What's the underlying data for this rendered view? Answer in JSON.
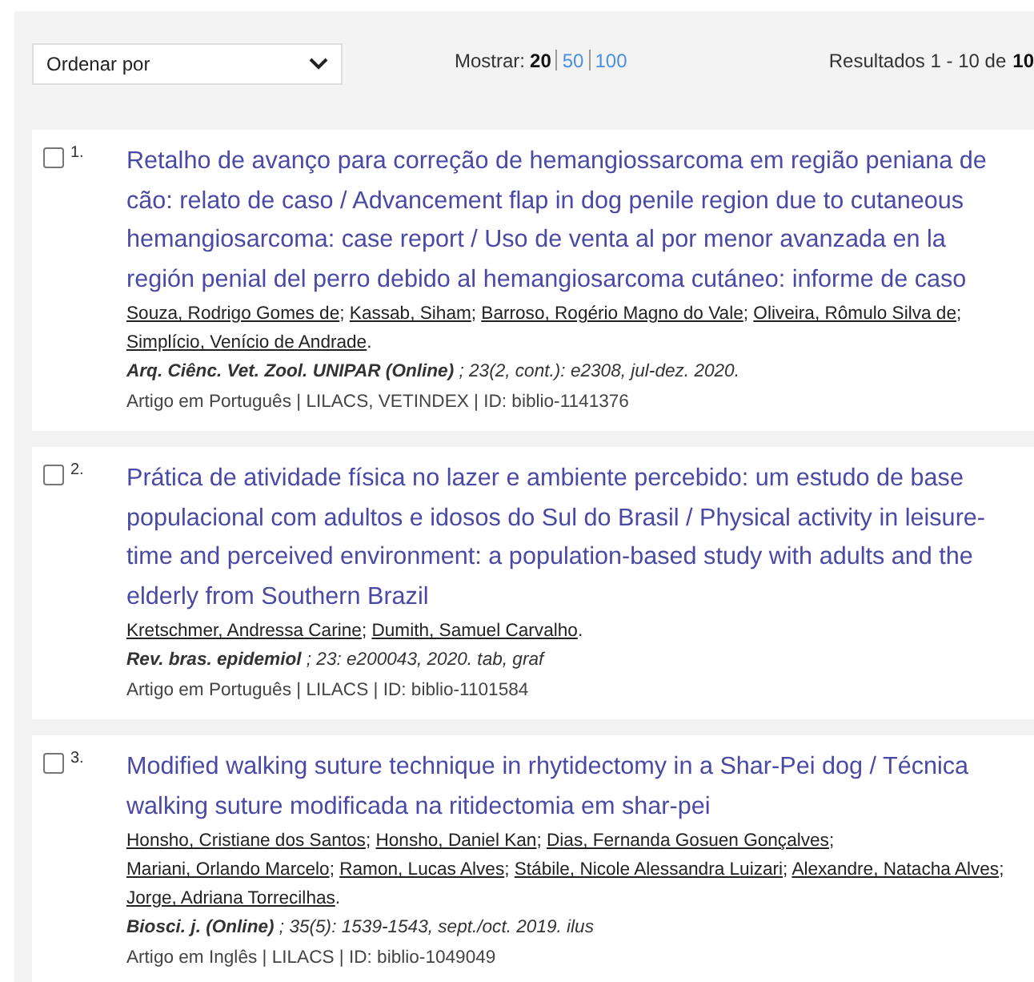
{
  "toolbar": {
    "sort": {
      "label": "Ordenar por"
    },
    "show": {
      "label": "Mostrar:",
      "options": [
        {
          "label": "20",
          "selected": true
        },
        {
          "label": "50",
          "selected": false
        },
        {
          "label": "100",
          "selected": false
        }
      ]
    },
    "results": {
      "label": "Resultados 1 - 10 de",
      "total": "10"
    }
  },
  "results": [
    {
      "checked": false,
      "number": "1.",
      "title": "Retalho de avanço para correção de hemangiossarcoma em região peniana de cão: relato de caso / Advancement flap in dog penile region due to cutaneous hemangiosarcoma: case report / Uso de venta al por menor avanzada en la región penial del perro debido al hemangiosarcoma cutáneo: informe de caso",
      "authors": [
        {
          "name": "Souza, Rodrigo Gomes de",
          "after": ";"
        },
        {
          "name": "Kassab, Siham",
          "after": ";"
        },
        {
          "name": "Barroso, Rogério Magno do Vale",
          "after": ";"
        },
        {
          "name": "Oliveira, Rômulo Silva de",
          "after": ";"
        },
        {
          "name": "Simplício, Venício de Andrade",
          "after": "."
        }
      ],
      "source": "**Arq. Ciênc. Vet. Zool. UNIPAR (Online)** ; 23(2, cont.): e2308, jul-dez. 2020.",
      "meta": "Artigo em Português | LILACS, VETINDEX | ID: biblio-1141376"
    },
    {
      "checked": false,
      "number": "2.",
      "title": "Prática de atividade física no lazer e ambiente percebido: um estudo de base populacional com adultos e idosos do Sul do Brasil / Physical activity in leisure-time and perceived environment: a population-based study with adults and the elderly from Southern Brazil",
      "authors": [
        {
          "name": "Kretschmer, Andressa Carine",
          "after": ";"
        },
        {
          "name": "Dumith, Samuel Carvalho",
          "after": "."
        }
      ],
      "source": "**Rev. bras. epidemiol** ; 23: e200043, 2020. tab, graf",
      "meta": "Artigo em Português | LILACS | ID: biblio-1101584"
    },
    {
      "checked": false,
      "number": "3.",
      "title": "Modified walking suture technique in rhytidectomy in a Shar-Pei dog / Técnica walking suture modificada na ritidectomia em shar-pei",
      "authors": [
        {
          "name": "Honsho, Cristiane dos Santos",
          "after": ";"
        },
        {
          "name": "Honsho, Daniel Kan",
          "after": ";"
        },
        {
          "name": "Dias, Fernanda Gosuen Gonçalves",
          "after": ";"
        },
        {
          "name": "Mariani, Orlando Marcelo",
          "after": ";"
        },
        {
          "name": "Ramon, Lucas Alves",
          "after": ";"
        },
        {
          "name": "Stábile, Nicole Alessandra Luizari",
          "after": ";"
        },
        {
          "name": "Alexandre, Natacha Alves",
          "after": ";"
        },
        {
          "name": "Jorge, Adriana Torrecilhas",
          "after": "."
        }
      ],
      "source": "**Biosci. j. (Online)** ; 35(5): 1539-1543, sept./oct. 2019. ilus",
      "meta": "Artigo em Inglês | LILACS | ID: biblio-1049049"
    }
  ]
}
